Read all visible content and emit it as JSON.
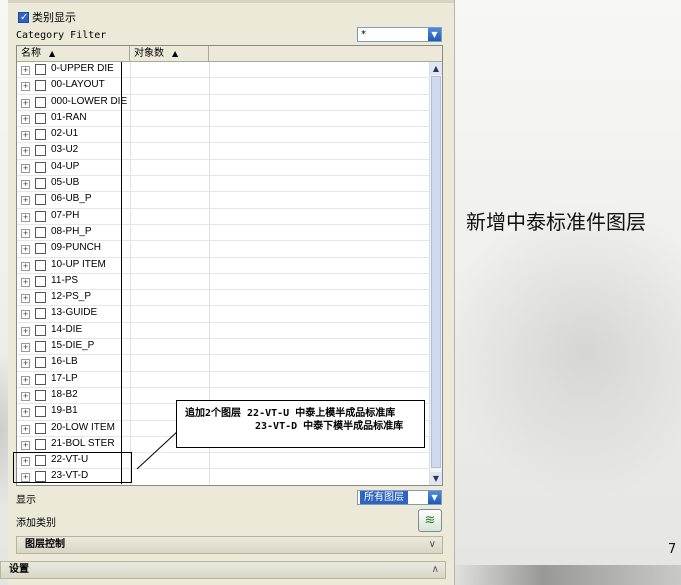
{
  "panel": {
    "category_display": {
      "label": "类别显示",
      "checked": true
    },
    "category_filter": {
      "label": "Category Filter",
      "value": "*"
    },
    "table": {
      "columns": [
        {
          "label": "名称",
          "sort": "▲"
        },
        {
          "label": "对象数",
          "sort": "▲"
        }
      ],
      "rows": [
        "0-UPPER DIE",
        "00-LAYOUT",
        "000-LOWER DIE",
        "01-RAN",
        "02-U1",
        "03-U2",
        "04-UP",
        "05-UB",
        "06-UB_P",
        "07-PH",
        "08-PH_P",
        "09-PUNCH",
        "10-UP ITEM",
        "11-PS",
        "12-PS_P",
        "13-GUIDE",
        "14-DIE",
        "15-DIE_P",
        "16-LB",
        "17-LP",
        "18-B2",
        "19-B1",
        "20-LOW ITEM",
        "21-BOL STER",
        "22-VT-U",
        "23-VT-D"
      ]
    },
    "show": {
      "label": "显示",
      "value": "所有图层"
    },
    "add_category": {
      "label": "添加类别"
    },
    "layer_control": {
      "label": "图层控制"
    },
    "settings": {
      "label": "设置"
    }
  },
  "annotation": {
    "line1": "追加2个图层  22-VT-U 中泰上模半成品标准库",
    "line2": "23-VT-D 中泰下模半成品标准库"
  },
  "slide": {
    "title": "新增中泰标准件图层",
    "page_number": "7"
  }
}
